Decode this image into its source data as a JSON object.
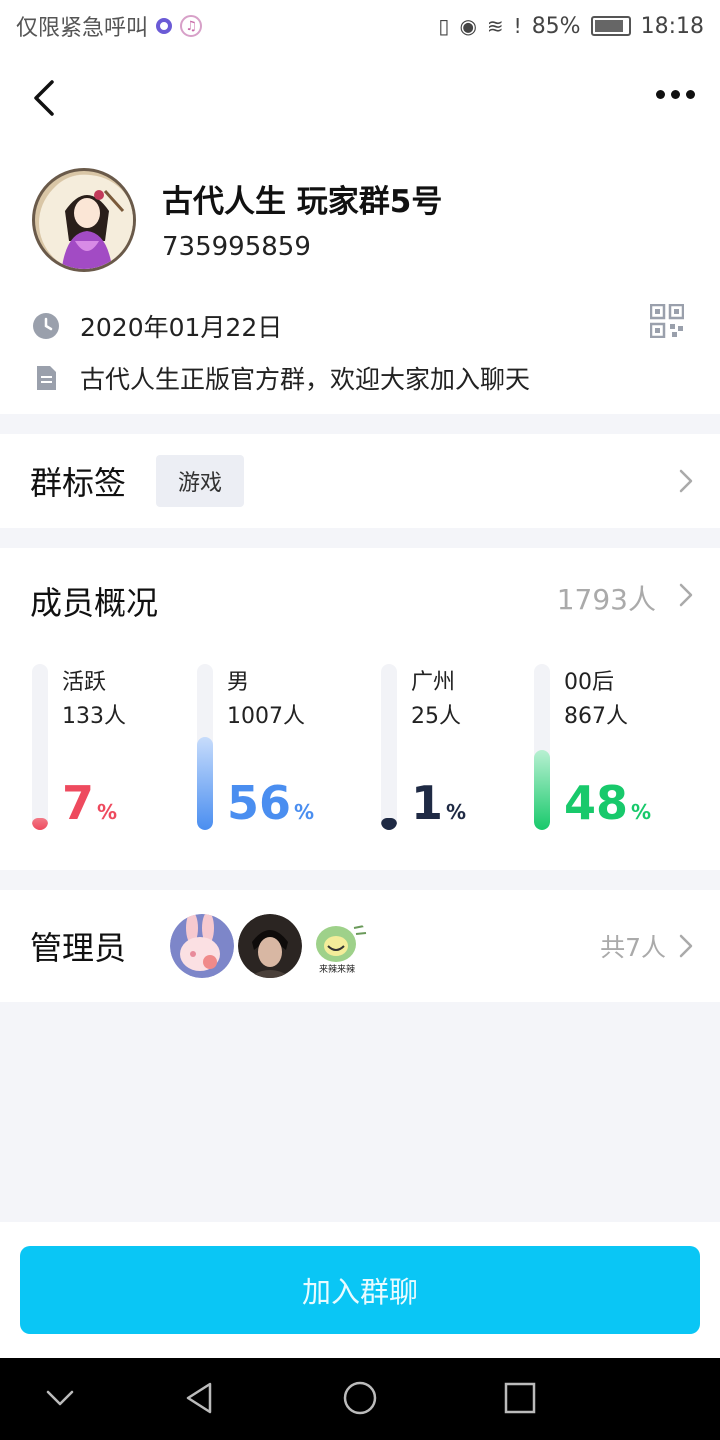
{
  "status": {
    "carrier": "仅限紧急呼叫",
    "battery": "85%",
    "time": "18:18"
  },
  "group": {
    "name": "古代人生 玩家群5号",
    "id": "735995859",
    "created": "2020年01月22日",
    "description": "古代人生正版官方群，欢迎大家加入聊天"
  },
  "tags": {
    "title": "群标签",
    "items": [
      "游戏"
    ]
  },
  "members": {
    "title": "成员概况",
    "total": "1793人",
    "stats": [
      {
        "label": "活跃",
        "count": "133人",
        "percent": 7,
        "color": "#ee4a5e",
        "fill_top": "#f27a87",
        "fill_bottom": "#ee4a5e"
      },
      {
        "label": "男",
        "count": "1007人",
        "percent": 56,
        "color": "#4a8ef0",
        "fill_top": "#c7dcfb",
        "fill_bottom": "#4a8ef0"
      },
      {
        "label": "广州",
        "count": "25人",
        "percent": 1,
        "color": "#1f2a44",
        "fill_top": "#1f2a44",
        "fill_bottom": "#1f2a44"
      },
      {
        "label": "00后",
        "count": "867人",
        "percent": 48,
        "color": "#18c96b",
        "fill_top": "#b8f0d2",
        "fill_bottom": "#18c96b"
      }
    ],
    "percent_unit": "%"
  },
  "admins": {
    "title": "管理员",
    "total": "共7人",
    "avatar_badge_text": "来辣来辣"
  },
  "actions": {
    "join": "加入群聊"
  },
  "colors": {
    "accent": "#0ac6f5",
    "muted": "#aaaaaa"
  }
}
